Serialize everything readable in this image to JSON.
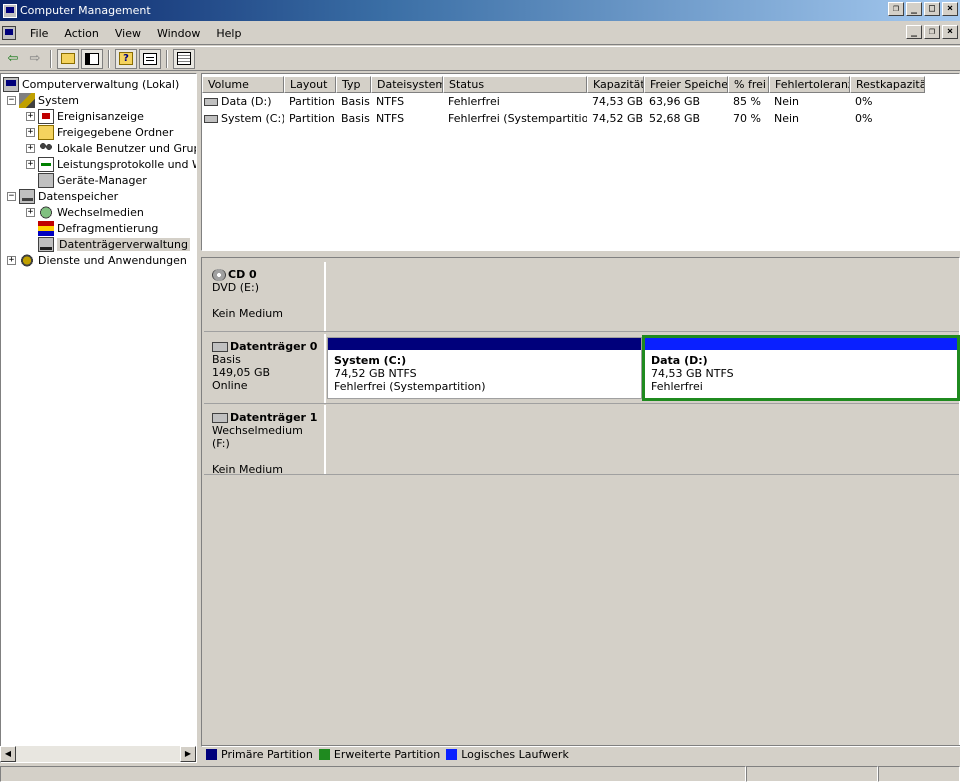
{
  "window": {
    "title": "Computer Management",
    "buttons": [
      "restore",
      "minimize",
      "maximize",
      "close"
    ]
  },
  "menu": {
    "items": [
      "File",
      "Action",
      "View",
      "Window",
      "Help"
    ]
  },
  "toolbar": {
    "icons": [
      "back-icon",
      "forward-icon",
      "up-folder-icon",
      "show-tree-icon",
      "help-icon",
      "properties-icon",
      "export-list-icon"
    ]
  },
  "tree": {
    "items": [
      {
        "label": "Computerverwaltung (Lokal)",
        "icon": "computer-icon",
        "level": 0,
        "expander": ""
      },
      {
        "label": "System",
        "icon": "system-tools-icon",
        "level": 1,
        "expander": "-"
      },
      {
        "label": "Ereignisanzeige",
        "icon": "event-viewer-icon",
        "level": 2,
        "expander": "+"
      },
      {
        "label": "Freigegebene Ordner",
        "icon": "shared-folder-icon",
        "level": 2,
        "expander": "+"
      },
      {
        "label": "Lokale Benutzer und Gruppe",
        "icon": "users-icon",
        "level": 2,
        "expander": "+"
      },
      {
        "label": "Leistungsprotokolle und War",
        "icon": "performance-icon",
        "level": 2,
        "expander": "+"
      },
      {
        "label": "Geräte-Manager",
        "icon": "device-manager-icon",
        "level": 2,
        "expander": ""
      },
      {
        "label": "Datenspeicher",
        "icon": "storage-icon",
        "level": 1,
        "expander": "-"
      },
      {
        "label": "Wechselmedien",
        "icon": "removable-storage-icon",
        "level": 2,
        "expander": "+"
      },
      {
        "label": "Defragmentierung",
        "icon": "defrag-icon",
        "level": 2,
        "expander": ""
      },
      {
        "label": "Datenträgerverwaltung",
        "icon": "disk-management-icon",
        "level": 2,
        "expander": "",
        "selected": true
      },
      {
        "label": "Dienste und Anwendungen",
        "icon": "services-icon",
        "level": 1,
        "expander": "+"
      }
    ]
  },
  "volumes": {
    "columns": [
      "Volume",
      "Layout",
      "Typ",
      "Dateisystem",
      "Status",
      "Kapazität",
      "Freier Speicher",
      "% frei",
      "Fehlertoleranz",
      "Restkapazität"
    ],
    "rows": [
      [
        "Data (D:)",
        "Partition",
        "Basis",
        "NTFS",
        "Fehlerfrei",
        "74,53 GB",
        "63,96 GB",
        "85 %",
        "Nein",
        "0%"
      ],
      [
        "System (C:)",
        "Partition",
        "Basis",
        "NTFS",
        "Fehlerfrei (Systempartition)",
        "74,52 GB",
        "52,68 GB",
        "70 %",
        "Nein",
        "0%"
      ]
    ]
  },
  "disks": [
    {
      "name": "CD 0",
      "line1": "DVD (E:)",
      "line2": "",
      "line3": "Kein Medium",
      "body": ""
    },
    {
      "name": "Datenträger 0",
      "line1": "Basis",
      "line2": "149,05 GB",
      "line3": "Online",
      "partitions": [
        {
          "title": "System  (C:)",
          "size": "74,52 GB NTFS",
          "status": "Fehlerfrei (Systempartition)",
          "color": "#00007b"
        },
        {
          "title": "Data  (D:)",
          "size": "74,53 GB NTFS",
          "status": "Fehlerfrei",
          "color": "#0a20ff"
        }
      ]
    },
    {
      "name": "Datenträger 1",
      "line1": "Wechselmedium (F:)",
      "line2": "",
      "line3": "Kein Medium"
    }
  ],
  "legend": [
    {
      "label": "Primäre Partition",
      "color": "#00007b"
    },
    {
      "label": "Erweiterte Partition",
      "color": "#1f8a1f"
    },
    {
      "label": "Logisches Laufwerk",
      "color": "#0a20ff"
    }
  ]
}
